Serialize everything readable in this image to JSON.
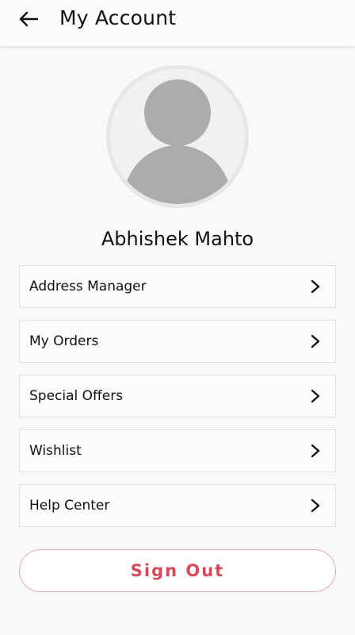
{
  "header": {
    "title": "My Account",
    "back_icon": "arrow-left-icon"
  },
  "profile": {
    "name": "Abhishek Mahto",
    "avatar_icon": "default-user-avatar-icon"
  },
  "menu": {
    "items": [
      {
        "label": "Address Manager",
        "icon": "chevron-right-icon"
      },
      {
        "label": "My Orders",
        "icon": "chevron-right-icon"
      },
      {
        "label": "Special Offers",
        "icon": "chevron-right-icon"
      },
      {
        "label": "Wishlist",
        "icon": "chevron-right-icon"
      },
      {
        "label": "Help Center",
        "icon": "chevron-right-icon"
      }
    ]
  },
  "signout": {
    "label": "Sign Out"
  },
  "colors": {
    "accent": "#d9475a",
    "accent_border": "#e6a9b0",
    "avatar_gray": "#acacac",
    "background": "#f8f9f8"
  }
}
